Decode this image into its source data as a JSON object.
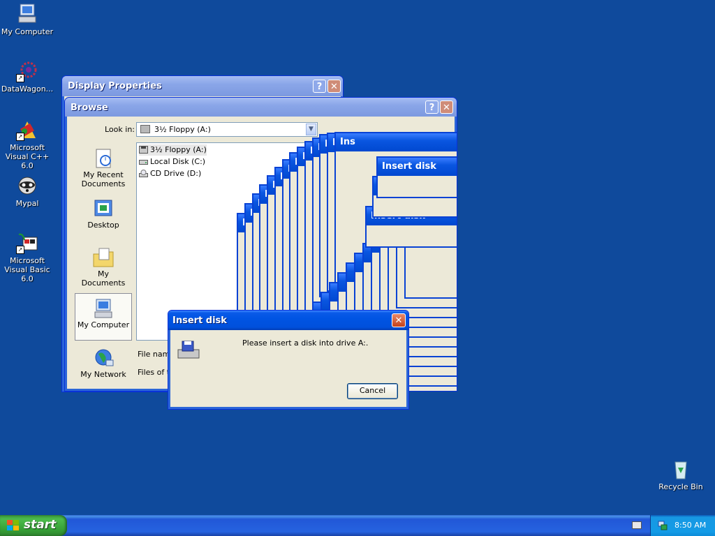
{
  "desktop": {
    "icons": [
      {
        "label": "My Computer",
        "icon": "my-computer-icon"
      },
      {
        "label": "DataWagon...",
        "icon": "datawagon-icon"
      },
      {
        "label": "Microsoft Visual C++ 6.0",
        "icon": "visual-cpp-icon"
      },
      {
        "label": "Mypal",
        "icon": "mypal-icon"
      },
      {
        "label": "Microsoft Visual Basic 6.0",
        "icon": "visual-basic-icon"
      },
      {
        "label": "Recycle Bin",
        "icon": "recycle-bin-icon"
      }
    ]
  },
  "display_properties": {
    "title": "Display Properties",
    "help": "?",
    "close": "✕"
  },
  "browse": {
    "title": "Browse",
    "help": "?",
    "close": "✕",
    "look_in_label": "Look in:",
    "look_in_value": "3½ Floppy (A:)",
    "places": [
      {
        "label": "My Recent Documents",
        "icon": "recent-documents-icon"
      },
      {
        "label": "Desktop",
        "icon": "desktop-icon"
      },
      {
        "label": "My Documents",
        "icon": "my-documents-icon"
      },
      {
        "label": "My Computer",
        "icon": "my-computer-icon"
      },
      {
        "label": "My Network",
        "icon": "my-network-icon"
      }
    ],
    "files": [
      {
        "name": "3½ Floppy (A:)",
        "icon": "floppy-drive-icon"
      },
      {
        "name": "Local Disk (C:)",
        "icon": "hard-disk-icon"
      },
      {
        "name": "CD Drive (D:)",
        "icon": "cd-drive-icon"
      }
    ],
    "file_name_label": "File name",
    "files_of_type_label": "Files of ty"
  },
  "stacked_dialogs": {
    "title": "Insert disk",
    "partial_titles": [
      "Ins",
      "In",
      "Insert disk"
    ]
  },
  "insert_disk": {
    "title": "Insert disk",
    "close": "✕",
    "message": "Please insert a disk into drive A:.",
    "cancel": "Cancel",
    "icon": "floppy-drive-icon"
  },
  "taskbar": {
    "start_label": "start",
    "clock": "8:50 AM",
    "tray_icons": [
      "keyboard-icon",
      "network-icon"
    ]
  }
}
